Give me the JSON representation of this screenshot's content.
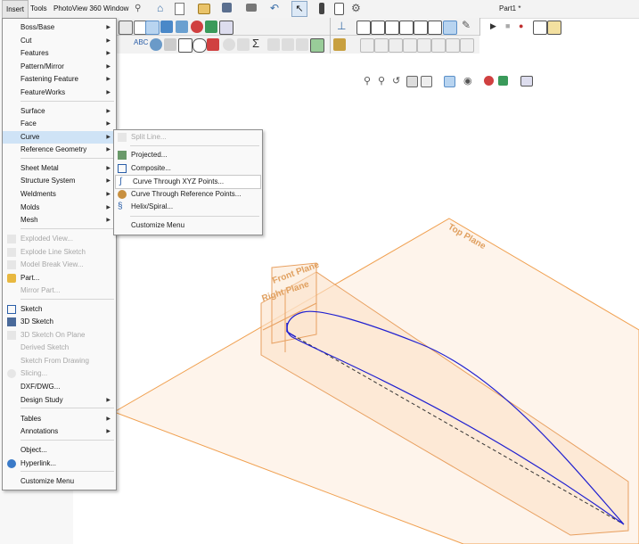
{
  "menubar": {
    "items": [
      "Insert",
      "Tools",
      "PhotoView 360",
      "Window"
    ],
    "doc_title": "Part1 *"
  },
  "insert_menu": {
    "items": [
      {
        "label": "Boss/Base",
        "submenu": true
      },
      {
        "label": "Cut",
        "submenu": true
      },
      {
        "label": "Features",
        "submenu": true
      },
      {
        "label": "Pattern/Mirror",
        "submenu": true
      },
      {
        "label": "Fastening Feature",
        "submenu": true
      },
      {
        "label": "FeatureWorks",
        "submenu": true
      },
      {
        "label": "Surface",
        "submenu": true
      },
      {
        "label": "Face",
        "submenu": true
      },
      {
        "label": "Curve",
        "submenu": true
      },
      {
        "label": "Reference Geometry",
        "submenu": true
      },
      {
        "label": "Sheet Metal",
        "submenu": true
      },
      {
        "label": "Structure System",
        "submenu": true
      },
      {
        "label": "Weldments",
        "submenu": true
      },
      {
        "label": "Molds",
        "submenu": true
      },
      {
        "label": "Mesh",
        "submenu": true
      },
      {
        "label": "Exploded View...",
        "disabled": true
      },
      {
        "label": "Explode Line Sketch",
        "disabled": true
      },
      {
        "label": "Model Break View...",
        "disabled": true
      },
      {
        "label": "Part..."
      },
      {
        "label": "Mirror Part...",
        "disabled": true
      },
      {
        "label": "Sketch"
      },
      {
        "label": "3D Sketch"
      },
      {
        "label": "3D Sketch On Plane",
        "disabled": true
      },
      {
        "label": "Derived Sketch",
        "disabled": true
      },
      {
        "label": "Sketch From Drawing",
        "disabled": true
      },
      {
        "label": "Slicing...",
        "disabled": true
      },
      {
        "label": "DXF/DWG..."
      },
      {
        "label": "Design Study",
        "submenu": true
      },
      {
        "label": "Tables",
        "submenu": true
      },
      {
        "label": "Annotations",
        "submenu": true
      },
      {
        "label": "Object..."
      },
      {
        "label": "Hyperlink..."
      },
      {
        "label": "Customize Menu"
      }
    ]
  },
  "curve_submenu": {
    "items": [
      {
        "label": "Split Line...",
        "disabled": true
      },
      {
        "label": "Projected..."
      },
      {
        "label": "Composite..."
      },
      {
        "label": "Curve Through XYZ Points..."
      },
      {
        "label": "Curve Through Reference Points..."
      },
      {
        "label": "Helix/Spiral..."
      },
      {
        "label": "Customize Menu"
      }
    ]
  },
  "viewport": {
    "planes": [
      "Top Plane",
      "Front Plane",
      "Right Plane"
    ]
  },
  "colors": {
    "plane": "#f0a050",
    "curve": "#2020d0",
    "menu_highlight": "#cfe3f6"
  }
}
